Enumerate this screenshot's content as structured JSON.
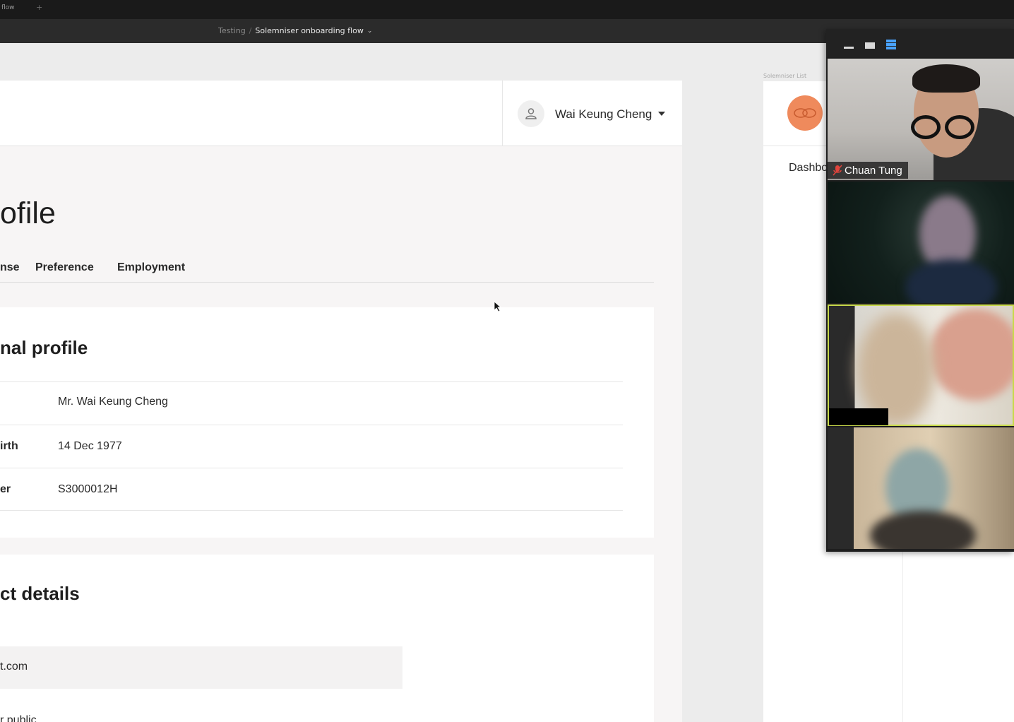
{
  "browser": {
    "tab_title": "flow",
    "new_tab": "+"
  },
  "breadcrumb": {
    "parent": "Testing",
    "separator": "/",
    "current": "Solemniser onboarding flow",
    "chevron": "⌄"
  },
  "header": {
    "user_name": "Wai Keung Cheng"
  },
  "page": {
    "title": "ofile",
    "tabs": [
      {
        "label": "nse"
      },
      {
        "label": "Preference"
      },
      {
        "label": "Employment"
      }
    ]
  },
  "personal": {
    "title": "nal profile",
    "rows": [
      {
        "label": "",
        "value": "Mr. Wai Keung Cheng"
      },
      {
        "label": "irth",
        "value": "14 Dec 1977"
      },
      {
        "label": "er",
        "value": "S3000012H"
      }
    ]
  },
  "contact": {
    "title": "ct details",
    "email": "t.com",
    "bottom_text": "r public"
  },
  "preview": {
    "frame_label": "Solemniser List",
    "nav_item": "Dashbo"
  },
  "video_call": {
    "participant_1": "Chuan Tung"
  },
  "colors": {
    "accent": "#ef8a5c",
    "speaker_highlight": "#c7d94a"
  }
}
